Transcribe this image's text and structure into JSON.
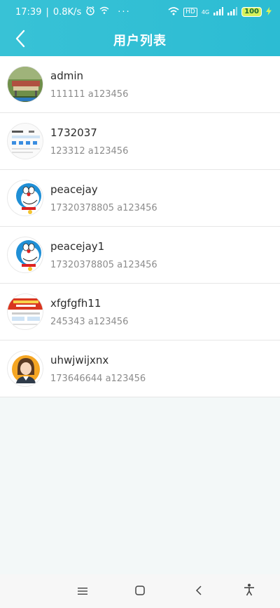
{
  "status": {
    "time": "17:39",
    "speed": "0.8K/s",
    "network": "4G",
    "hd": "HD",
    "battery": "100",
    "more": "···"
  },
  "header": {
    "title": "用户列表"
  },
  "users": [
    {
      "name": "admin",
      "detail": "111111 a123456",
      "avatar": "photo-avatar"
    },
    {
      "name": "1732037",
      "detail": "123312 a123456",
      "avatar": "screenshot-avatar"
    },
    {
      "name": "peacejay",
      "detail": "17320378805 a123456",
      "avatar": "doraemon-avatar"
    },
    {
      "name": "peacejay1",
      "detail": "17320378805 a123456",
      "avatar": "doraemon-avatar"
    },
    {
      "name": "xfgfgfh11",
      "detail": "245343 a123456",
      "avatar": "promo-avatar"
    },
    {
      "name": "uhwjwijxnx",
      "detail": "173646644 a123456",
      "avatar": "woman-avatar"
    }
  ],
  "colors": {
    "accent": "#2cbcd3",
    "background": "#f3f8f8"
  }
}
